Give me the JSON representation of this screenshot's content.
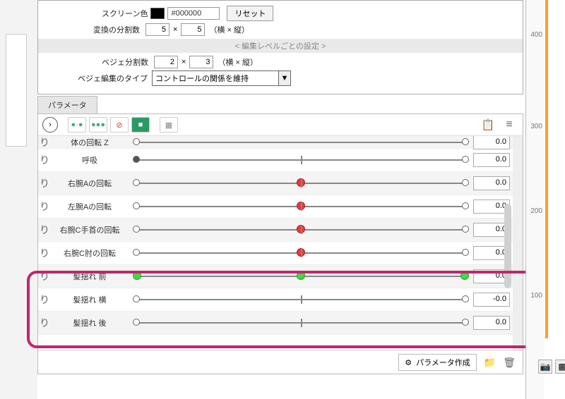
{
  "settings": {
    "screen_color_label": "スクリーン色",
    "screen_color_hex": "#000000",
    "reset_label": "リセット",
    "division_label": "変換の分割数",
    "division_x": "5",
    "division_y": "5",
    "division_suffix": "（横 × 縦）",
    "sub_header": "<  編集レベルごとの設定  >",
    "bezier_div_label": "ベジェ分割数",
    "bezier_div_x": "2",
    "bezier_div_y": "3",
    "bezier_suffix": "（横 × 縦）",
    "bezier_type_label": "ベジェ編集のタイプ",
    "bezier_type_value": "コントロールの関係を維持"
  },
  "panel": {
    "tab_label": "パラメータ",
    "create_param_label": "パラメータ作成"
  },
  "ruler": {
    "t400": "400",
    "t300": "300",
    "t200": "200",
    "t100": "100"
  },
  "params": [
    {
      "name": "体の回転 Z",
      "value": "0.0",
      "marker": "none",
      "alt": true,
      "cut": true
    },
    {
      "name": "呼吸",
      "value": "0.0",
      "marker": "start",
      "alt": false
    },
    {
      "name": "右腕Aの回転",
      "value": "0.0",
      "marker": "red",
      "alt": true
    },
    {
      "name": "左腕Aの回転",
      "value": "0.0",
      "marker": "red",
      "alt": false
    },
    {
      "name": "右腕C手首の回転",
      "value": "0.0",
      "marker": "red",
      "alt": true
    },
    {
      "name": "右腕C肘の回転",
      "value": "0.0",
      "marker": "red",
      "alt": false
    },
    {
      "name": "髪揺れ 前",
      "value": "0.0",
      "marker": "green3",
      "alt": true
    },
    {
      "name": "髪揺れ 横",
      "value": "-0.0",
      "marker": "plain",
      "alt": false
    },
    {
      "name": "髪揺れ 後",
      "value": "0.0",
      "marker": "plain",
      "alt": true
    }
  ]
}
